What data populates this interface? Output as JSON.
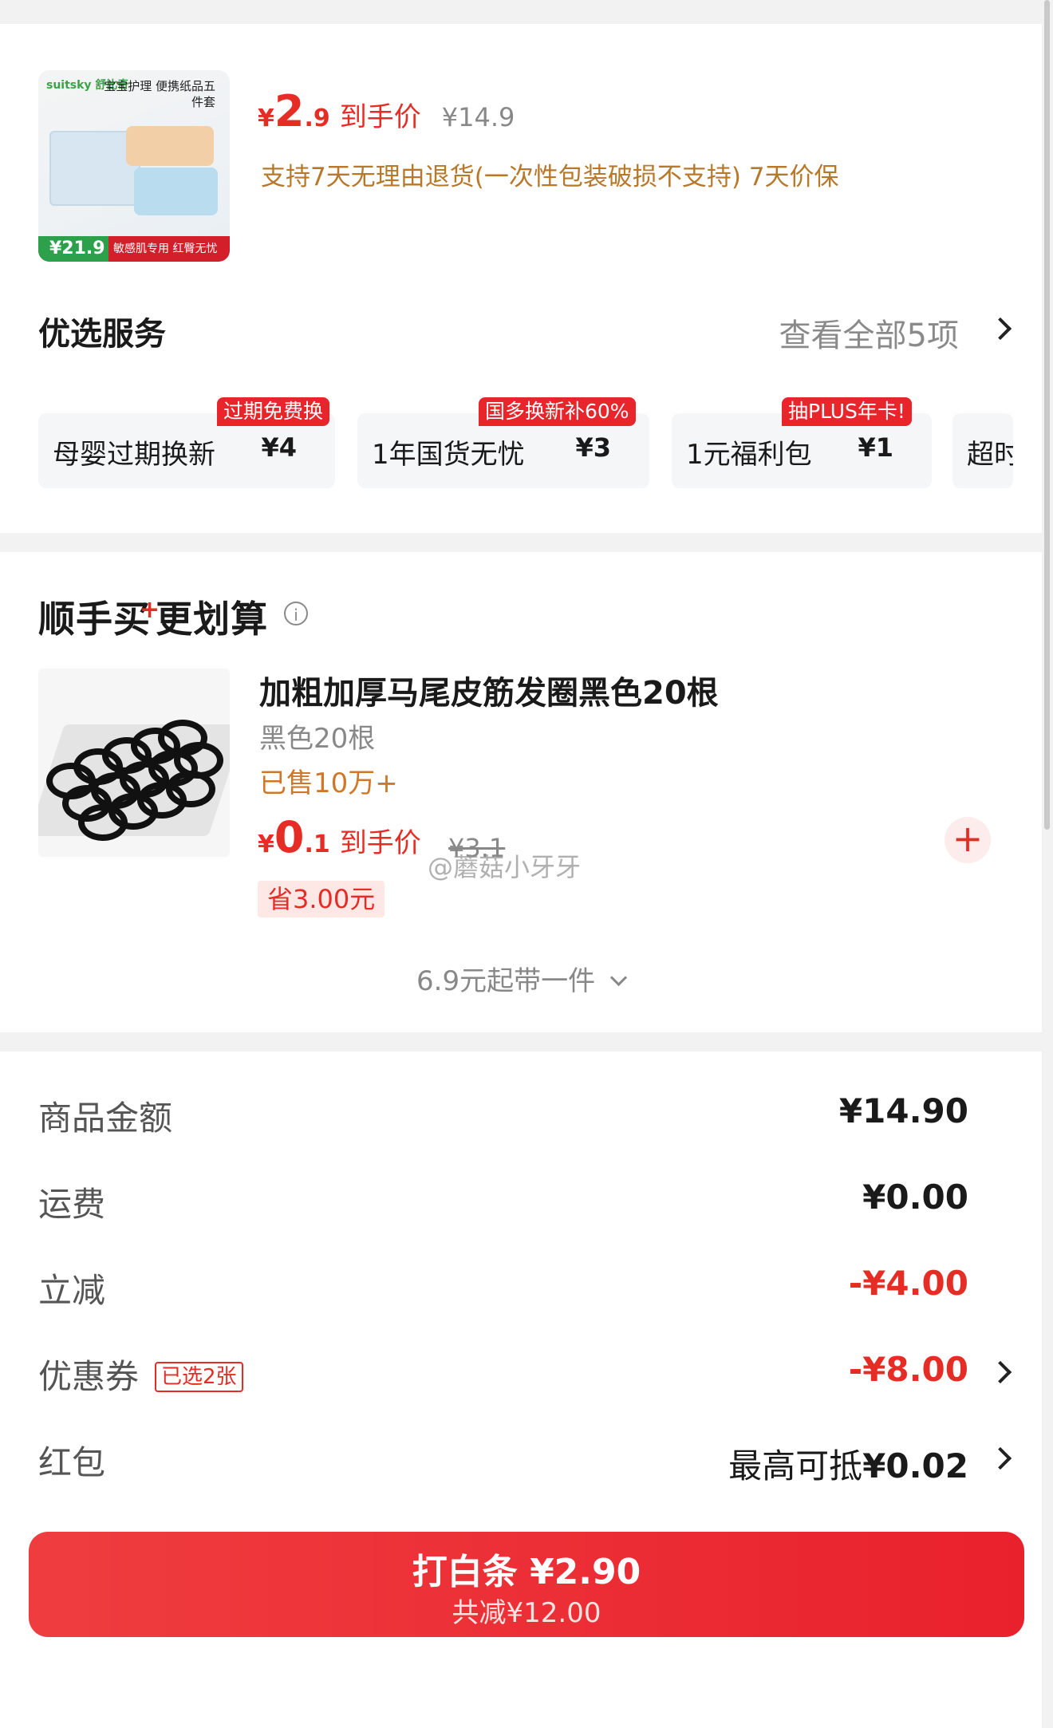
{
  "product": {
    "image": {
      "brand": "suitsky 舒比奇",
      "title": "宝宝护理 便携纸品五件套",
      "price_badge": "¥21.9",
      "footer": "敏感肌专用 红臀无忧"
    },
    "price": {
      "yen": "¥",
      "int": "2",
      "dec": ".9",
      "tag": "到手价",
      "original": "¥14.9"
    },
    "service": "支持7天无理由退货(一次性包装破损不支持) 7天价保"
  },
  "services": {
    "title": "优选服务",
    "see_all": "查看全部5项",
    "items": [
      {
        "name": "母婴过期换新",
        "price": "¥4",
        "badge": "过期免费换"
      },
      {
        "name": "1年国货无忧",
        "price": "¥3",
        "badge": "国多换新补60%"
      },
      {
        "name": "1元福利包",
        "price": "¥1",
        "badge": "抽PLUS年卡!"
      },
      {
        "name": "超时"
      }
    ]
  },
  "addon": {
    "title": "顺手买更划算",
    "plus": "+",
    "info_icon": "i",
    "item": {
      "title": "加粗加厚马尾皮筋发圈黑色20根",
      "spec": "黑色20根",
      "sold": "已售10万+",
      "price": {
        "yen": "¥",
        "int": "0",
        "dec": ".1",
        "tag": "到手价",
        "original": "¥3.1"
      },
      "save": "省3.00元",
      "add": "+"
    },
    "more": "6.9元起带一件",
    "watermark": "@蘑菇小牙牙"
  },
  "summary": {
    "goods_label": "商品金额",
    "goods_val": "¥14.90",
    "shipping_label": "运费",
    "shipping_val": "¥0.00",
    "discount_label": "立减",
    "discount_val": "-¥4.00",
    "coupon_label": "优惠券",
    "coupon_badge": "已选2张",
    "coupon_val": "-¥8.00",
    "redpacket_label": "红包",
    "redpacket_prefix": "最高可抵",
    "redpacket_val": "¥0.02"
  },
  "pay": {
    "main": "打白条 ¥2.90",
    "sub": "共减¥12.00"
  },
  "colors": {
    "accent": "#e52d26",
    "gold": "#b8782a",
    "button": "#e9212d"
  }
}
